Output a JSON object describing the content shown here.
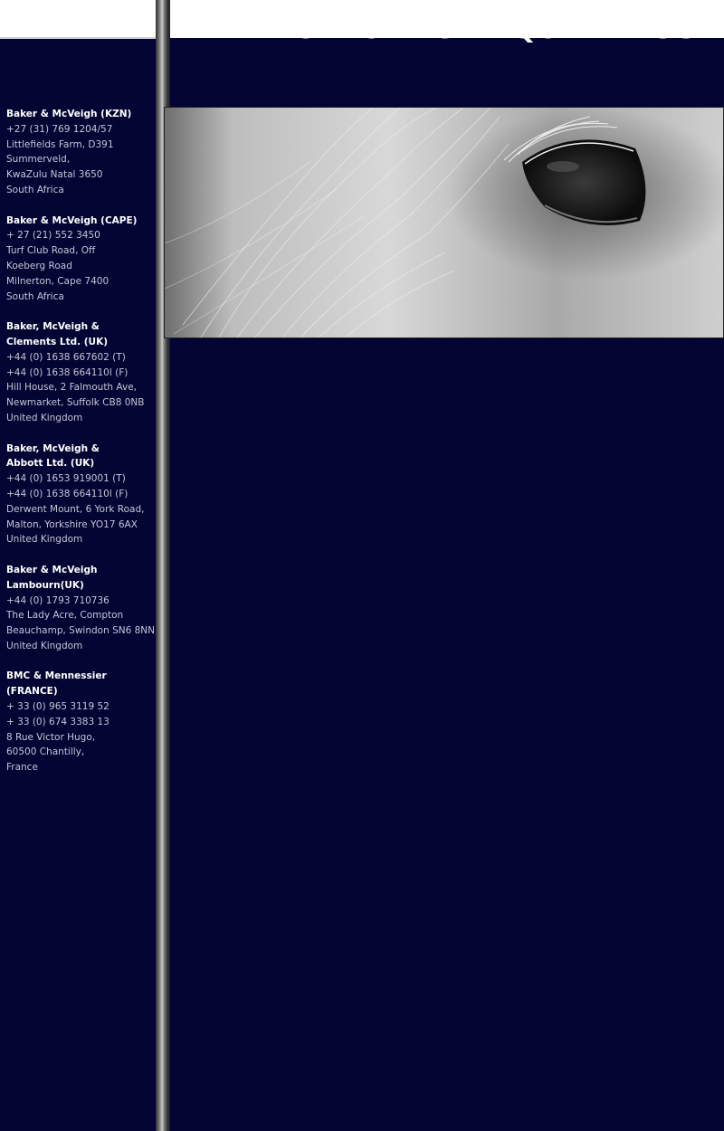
{
  "header": {
    "title": "BAKER & McVEIGH EQUINE HOSPITAL"
  },
  "hero": {
    "image_label": "horse-eye-photo"
  },
  "offices": [
    {
      "name_lines": [
        "Baker & McVeigh (KZN)"
      ],
      "lines": [
        "+27 (31) 769 1204/57",
        "Littlefields Farm, D391",
        "Summerveld,",
        "KwaZulu Natal 3650",
        "South Africa"
      ]
    },
    {
      "name_lines": [
        "Baker & McVeigh (CAPE)"
      ],
      "lines": [
        "+ 27 (21) 552 3450",
        "Turf Club Road, Off",
        "Koeberg Road",
        "Milnerton, Cape 7400",
        "South Africa"
      ]
    },
    {
      "name_lines": [
        "Baker, McVeigh &",
        "Clements Ltd. (UK)"
      ],
      "lines": [
        "+44 (0) 1638 667602 (T)",
        "+44 (0) 1638 664110l (F)",
        "Hill House, 2 Falmouth Ave,",
        "Newmarket, Suffolk CB8 0NB",
        "United Kingdom"
      ]
    },
    {
      "name_lines": [
        "Baker, McVeigh &",
        "Abbott Ltd. (UK)"
      ],
      "lines": [
        "+44 (0) 1653 919001 (T)",
        "+44 (0) 1638 664110l (F)",
        "Derwent Mount, 6 York Road,",
        "Malton, Yorkshire  YO17 6AX",
        "United Kingdom"
      ]
    },
    {
      "name_lines": [
        "Baker & McVeigh",
        "Lambourn(UK)"
      ],
      "lines": [
        "+44 (0) 1793 710736",
        "The Lady Acre, Compton",
        "Beauchamp, Swindon SN6 8NN",
        "United Kingdom"
      ]
    },
    {
      "name_lines": [
        "BMC & Mennessier (FRANCE)"
      ],
      "lines": [
        "+ 33 (0) 965 3119 52",
        "+ 33 (0) 674 3383 13",
        "8 Rue Victor Hugo,",
        "60500 Chantilly,",
        "France"
      ]
    }
  ]
}
